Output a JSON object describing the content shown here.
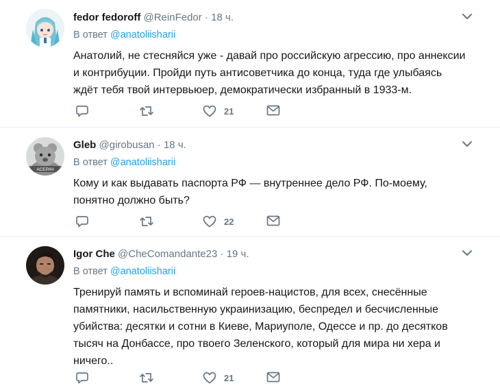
{
  "tweets": [
    {
      "name": "fedor fedoroff",
      "handle": "@ReinFedor",
      "dot": "·",
      "time": "18 ч.",
      "reply_prefix": "В ответ",
      "reply_to": "@anatoliisharii",
      "lines": [
        "Анатолий, не стесняйся уже - давай про российскую агрессию, про аннексии",
        "и контрибуции. Пройди путь антисоветчика до конца, туда где улыбаясь",
        "ждёт тебя твой интервьюер, демократически избранный в 1933-м."
      ],
      "likes": "21"
    },
    {
      "name": "Gleb",
      "handle": "@girobusan",
      "dot": "·",
      "time": "18 ч.",
      "reply_prefix": "В ответ",
      "reply_to": "@anatoliisharii",
      "avatar_text": "АСЕРАЧ",
      "lines": [
        "Кому и как выдавать паспорта РФ — внутреннее дело РФ. По-моему,",
        "понятно должно быть?"
      ],
      "likes": "22"
    },
    {
      "name": "Igor Che",
      "handle": "@CheComandante23",
      "dot": "·",
      "time": "19 ч.",
      "reply_prefix": "В ответ",
      "reply_to": "@anatoliisharii",
      "lines": [
        "Тренируй память и вспоминай героев-нацистов, для всех, снесённые",
        "памятники, насильственную украинизацию, беспредел и бесчисленные",
        "убийства: десятки и сотни в Киеве, Мариуполе, Одессе и пр. до десятков",
        "тысяч на Донбассе, про твоего Зеленского, который для мира ни хера и",
        "ничего.."
      ],
      "likes": "21"
    }
  ],
  "icons": {
    "reply": "reply-icon",
    "retweet": "retweet-icon",
    "like": "heart-icon",
    "dm": "envelope-icon",
    "caret": "chevron-down-icon"
  },
  "colors": {
    "link": "#1da1f2",
    "muted": "#657786",
    "divider": "#e6ecf0"
  }
}
